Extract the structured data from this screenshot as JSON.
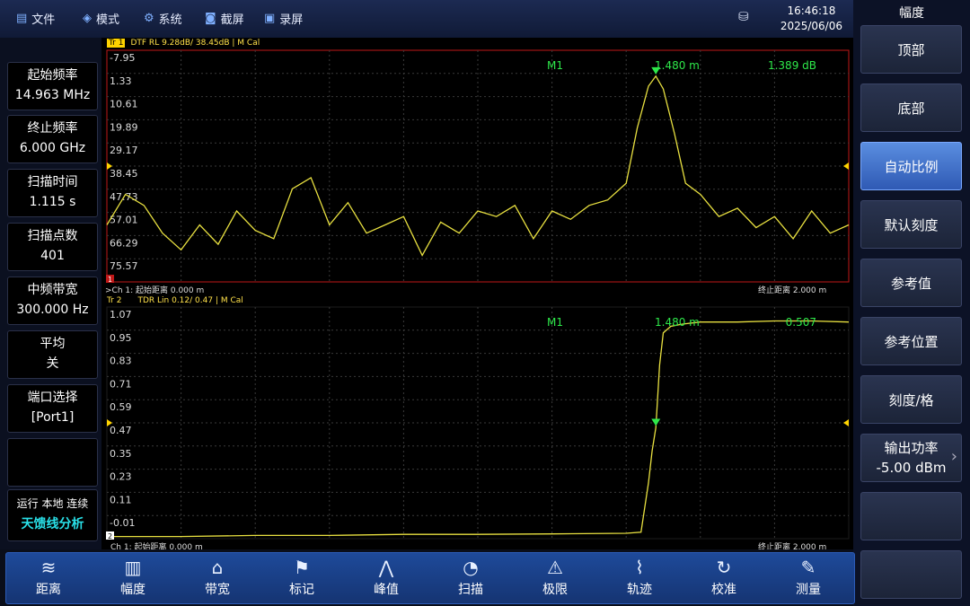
{
  "topbar": {
    "menus": [
      {
        "label": "文件",
        "icon": "file-icon"
      },
      {
        "label": "模式",
        "icon": "mode-icon"
      },
      {
        "label": "系统",
        "icon": "gear-icon"
      },
      {
        "label": "截屏",
        "icon": "camera-icon"
      },
      {
        "label": "录屏",
        "icon": "record-icon"
      }
    ],
    "time": "16:46:18",
    "date": "2025/06/06"
  },
  "left": {
    "params": [
      {
        "label": "起始频率",
        "value": "14.963 MHz"
      },
      {
        "label": "终止频率",
        "value": "6.000 GHz"
      },
      {
        "label": "扫描时间",
        "value": "1.115 s"
      },
      {
        "label": "扫描点数",
        "value": "401"
      },
      {
        "label": "中频带宽",
        "value": "300.000 Hz"
      },
      {
        "label": "平均",
        "value": "关"
      },
      {
        "label": "端口选择",
        "value": "[Port1]"
      }
    ],
    "status_line": "运行 本地 连续",
    "mode": "天馈线分析"
  },
  "trace1": {
    "tag": "Tr 1",
    "label": "DTF RL 9.28dB/ 38.45dB | M Cal",
    "ticks": [
      "-7.95",
      "1.33",
      "10.61",
      "19.89",
      "29.17",
      "38.45",
      "47.73",
      "57.01",
      "66.29",
      "75.57"
    ],
    "marker": {
      "name": "M1",
      "x": "1.480 m",
      "value": "1.389 dB"
    },
    "footer_left": ">Ch 1: 起始距离   0.000 m",
    "footer_right": "终止距离   2.000 m",
    "index": "1"
  },
  "trace2": {
    "tag": "Tr 2",
    "label": "TDR Lin 0.12/ 0.47 | M Cal",
    "ticks": [
      "1.07",
      "0.95",
      "0.83",
      "0.71",
      "0.59",
      "0.47",
      "0.35",
      "0.23",
      "0.11",
      "-0.01"
    ],
    "marker": {
      "name": "M1",
      "x": "1.480 m",
      "value": "0.507"
    },
    "footer_left": "Ch 1: 起始距离   0.000 m",
    "footer_right": "终止距离   2.000 m",
    "index": "2"
  },
  "right": {
    "title": "幅度",
    "buttons": [
      {
        "label": "顶部"
      },
      {
        "label": "底部"
      },
      {
        "label": "自动比例",
        "active": true
      },
      {
        "label": "默认刻度"
      },
      {
        "label": "参考值"
      },
      {
        "label": "参考位置"
      },
      {
        "label": "刻度/格"
      },
      {
        "label": "输出功率",
        "value": "-5.00 dBm"
      },
      {
        "label": ""
      },
      {
        "label": ""
      }
    ]
  },
  "bottom": {
    "buttons": [
      {
        "label": "距离",
        "icon": "distance-icon"
      },
      {
        "label": "幅度",
        "icon": "amplitude-icon"
      },
      {
        "label": "带宽",
        "icon": "bandwidth-icon"
      },
      {
        "label": "标记",
        "icon": "marker-flag-icon"
      },
      {
        "label": "峰值",
        "icon": "peak-icon"
      },
      {
        "label": "扫描",
        "icon": "sweep-icon"
      },
      {
        "label": "极限",
        "icon": "limit-warning-icon"
      },
      {
        "label": "轨迹",
        "icon": "trace-icon"
      },
      {
        "label": "校准",
        "icon": "calibrate-icon"
      },
      {
        "label": "测量",
        "icon": "measure-icon"
      }
    ]
  },
  "chart_data": [
    {
      "type": "line",
      "name": "Tr 1",
      "x_range": [
        0,
        2
      ],
      "ylim": [
        75.57,
        -7.95
      ],
      "x": [
        0,
        0.05,
        0.1,
        0.15,
        0.2,
        0.25,
        0.3,
        0.35,
        0.4,
        0.45,
        0.5,
        0.55,
        0.6,
        0.65,
        0.7,
        0.75,
        0.8,
        0.85,
        0.9,
        0.95,
        1.0,
        1.05,
        1.1,
        1.15,
        1.2,
        1.25,
        1.3,
        1.35,
        1.4,
        1.43,
        1.46,
        1.48,
        1.5,
        1.53,
        1.56,
        1.6,
        1.65,
        1.7,
        1.75,
        1.8,
        1.85,
        1.9,
        1.95,
        2.0
      ],
      "y": [
        55,
        44,
        48,
        58,
        64,
        55,
        62,
        50,
        57,
        60,
        42,
        38,
        55,
        47,
        58,
        55,
        52,
        66,
        54,
        58,
        50,
        52,
        48,
        60,
        50,
        53,
        48,
        46,
        40,
        20,
        5,
        1.389,
        6,
        22,
        40,
        44,
        52,
        49,
        56,
        52,
        60,
        50,
        58,
        55
      ]
    },
    {
      "type": "line",
      "name": "Tr 2",
      "x_range": [
        0,
        2
      ],
      "ylim": [
        -0.01,
        1.07
      ],
      "x": [
        0,
        0.2,
        0.4,
        0.6,
        0.8,
        1.0,
        1.2,
        1.4,
        1.44,
        1.46,
        1.47,
        1.48,
        1.49,
        1.5,
        1.52,
        1.55,
        1.6,
        1.7,
        1.8,
        1.9,
        2.0
      ],
      "y": [
        0.0,
        0.0,
        0.005,
        0.005,
        0.01,
        0.01,
        0.012,
        0.015,
        0.02,
        0.25,
        0.4,
        0.507,
        0.8,
        0.95,
        0.98,
        0.99,
        1.0,
        1.0,
        1.005,
        1.005,
        1.0
      ]
    }
  ]
}
